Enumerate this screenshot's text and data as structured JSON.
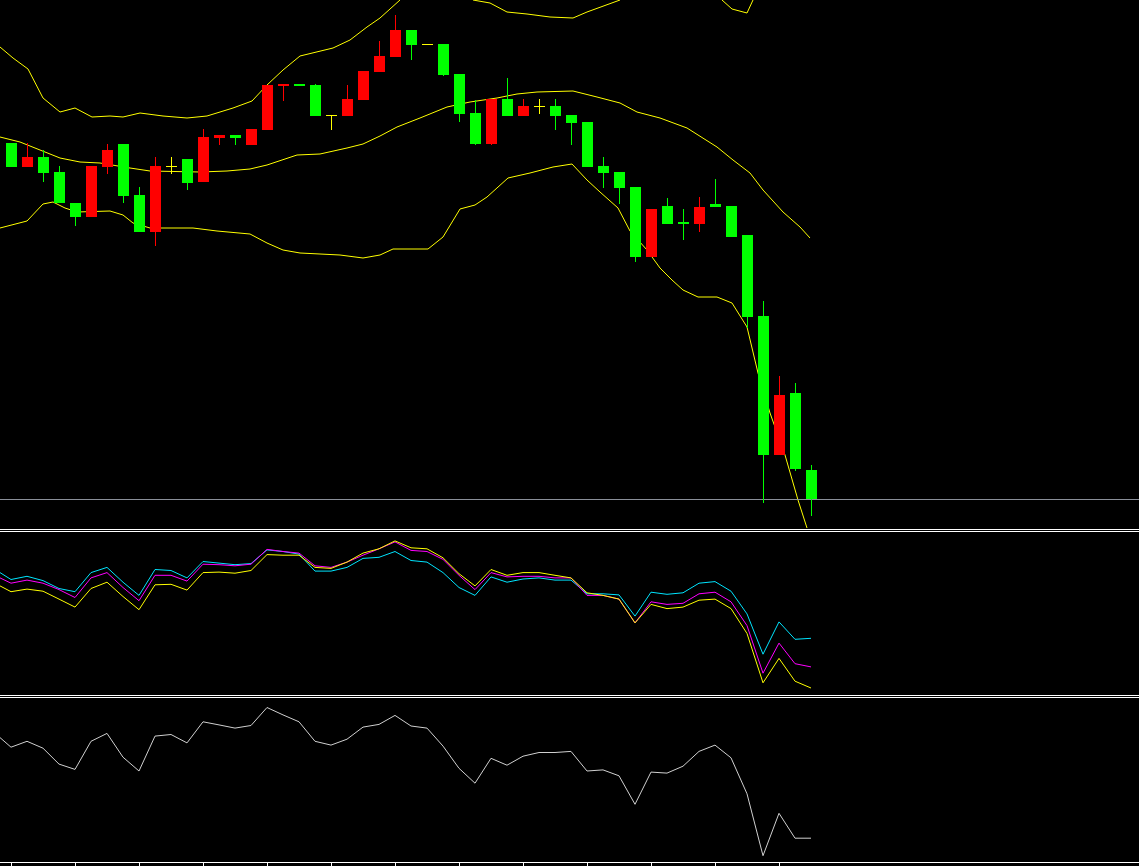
{
  "panels": [
    {
      "kind": "candles",
      "overlays": [
        {
          "kind": "bands"
        },
        {
          "kind": "level"
        }
      ]
    },
    {
      "kind": "lines",
      "series": [
        {
          "color": "#00e5ff"
        },
        {
          "color": "#ff00ff"
        },
        {
          "color": "#ffff00"
        }
      ]
    },
    {
      "kind": "lines",
      "series": [
        {
          "color": "#d0d0d0"
        }
      ]
    }
  ]
}
